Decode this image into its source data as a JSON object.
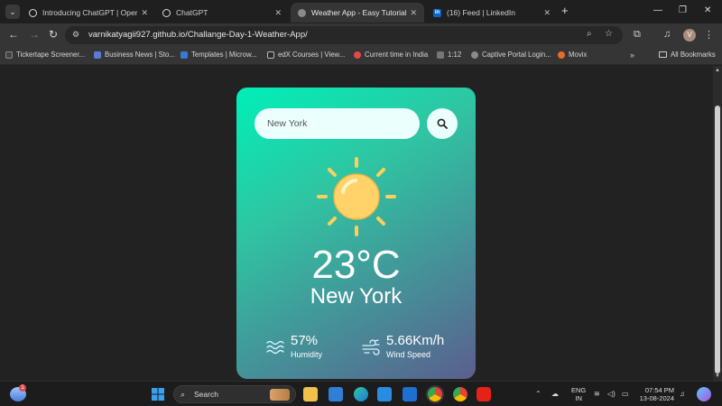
{
  "browser": {
    "tabs": [
      {
        "title": "Introducing ChatGPT | OpenAI",
        "icon": "chatgpt-icon"
      },
      {
        "title": "ChatGPT",
        "icon": "chatgpt-icon"
      },
      {
        "title": "Weather App - Easy Tutorials",
        "icon": "globe-icon",
        "active": true
      },
      {
        "title": "(16) Feed | LinkedIn",
        "icon": "linkedin-icon"
      }
    ],
    "url": "varnikatyagii927.github.io/Challange-Day-1-Weather-App/",
    "profile_initial": "V",
    "bookmarks": [
      "Tickertape Screener...",
      "Business News | Sto...",
      "Templates | Microw...",
      "edX Courses | View...",
      "Current time in India",
      "1:12",
      "Captive Portal Login...",
      "Movix"
    ],
    "all_bookmarks_label": "All Bookmarks"
  },
  "weather": {
    "search": {
      "value": "New York"
    },
    "temperature": "23°C",
    "city": "New York",
    "humidity": {
      "value": "57%",
      "label": "Humidity"
    },
    "wind": {
      "value": "5.66Km/h",
      "label": "Wind Speed"
    },
    "icon": "sun-icon"
  },
  "taskbar": {
    "search_label": "Search",
    "language": {
      "line1": "ENG",
      "line2": "IN"
    },
    "time": "07:54 PM",
    "date": "13-08-2024",
    "notification_count": "1"
  },
  "colors": {
    "card_gradient_start": "#00f0b8",
    "card_gradient_end": "#5a5f8e",
    "sun_core": "#ffd36a",
    "sun_rays": "#ffcf5a"
  }
}
